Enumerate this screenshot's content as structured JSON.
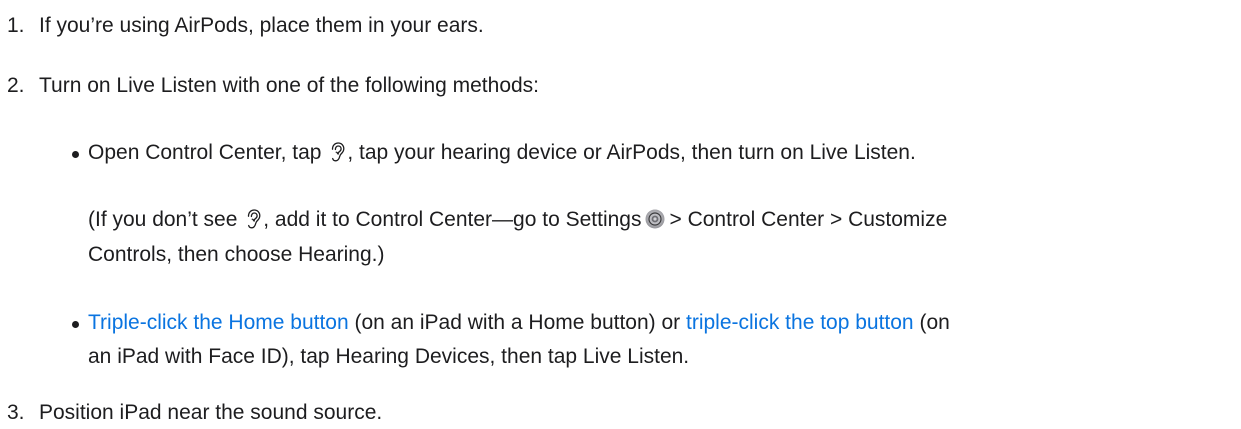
{
  "steps": [
    {
      "number": "1.",
      "text": "If you’re using AirPods, place them in your ears."
    },
    {
      "number": "2.",
      "text": "Turn on Live Listen with one of the following methods:"
    },
    {
      "number": "3.",
      "text": "Position iPad near the sound source."
    }
  ],
  "method_1": {
    "part_a": "Open Control Center, tap ",
    "icon": "hearing-ear-icon",
    "part_b": ", tap your hearing device or AirPods, then turn on Live Listen."
  },
  "note": {
    "line1_a": "(If you don’t see ",
    "line1_icon": "hearing-ear-icon",
    "line1_b": ", add it to Control Center—go to Settings",
    "settings_icon": "settings-gear-icon",
    "line1_c": "> Control Center > Customize",
    "line2": "Controls, then choose Hearing.)"
  },
  "method_2": {
    "link1": "Triple-click the Home button",
    "mid1": " (on an iPad with a Home button) or ",
    "link2": "triple-click the top button",
    "mid2": " (on",
    "line2": "an iPad with Face ID), tap Hearing Devices, then tap Live Listen."
  },
  "colors": {
    "text": "#1d1d1f",
    "link": "#0a74e0"
  }
}
